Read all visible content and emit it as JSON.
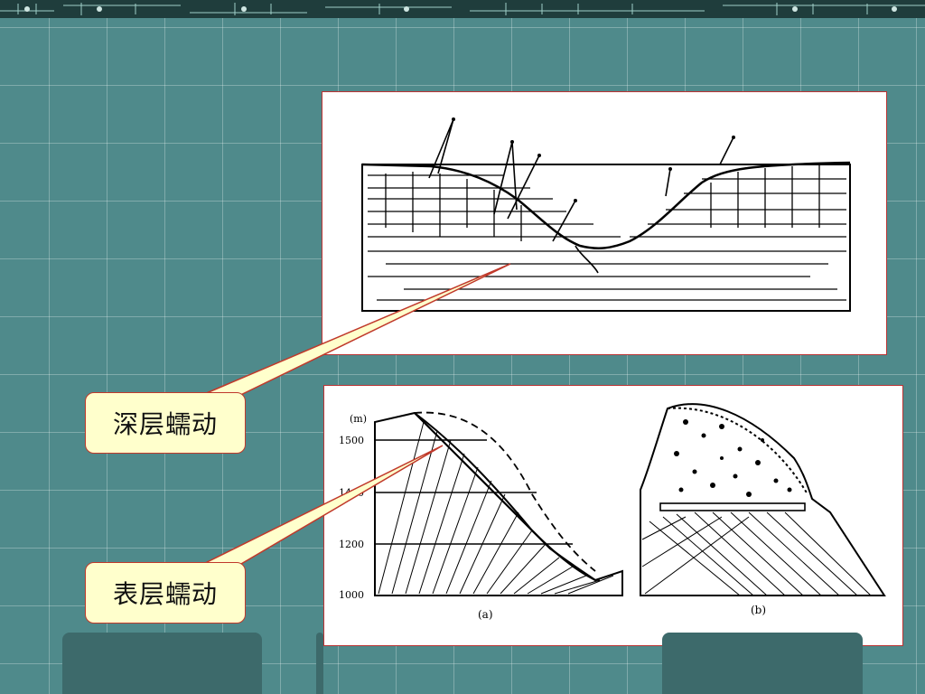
{
  "callouts": {
    "deep_creep": "深层蠕动",
    "surface_creep": "表层蠕动"
  },
  "figure_bottom": {
    "y_unit": "(m)",
    "y_ticks": [
      "1500",
      "1400",
      "1200",
      "1000"
    ],
    "label_a": "(a)",
    "label_b": "(b)"
  },
  "colors": {
    "background": "#4f8a8b",
    "callout_fill": "#ffffcc",
    "callout_border": "#c0392b"
  }
}
